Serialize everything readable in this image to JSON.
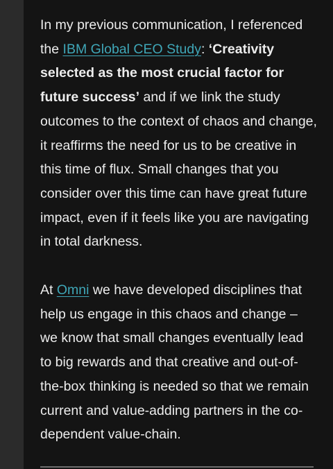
{
  "article": {
    "paragraph1": {
      "intro": "In my previous communication, I referenced the ",
      "link": "IBM Global CEO Study",
      "colon": ": ",
      "quote": "‘Creativity selected as the most crucial factor for future success’",
      "rest": " and if we link the study outcomes to the context of chaos and change, it reaffirms the need for us to be creative in this time of flux. Small changes that you consider over this time can have great future impact, even if it feels like you are navigating in total darkness."
    },
    "paragraph2": {
      "intro": "At ",
      "link": "Omni",
      "rest": " we have developed disciplines that help us engage in this chaos and change – we know that small changes eventually lead to big rewards and that creative and out-of-the-box thinking is needed so that we remain current and value-adding partners in the co-dependent value-chain."
    }
  },
  "colors": {
    "page_background": "#2b2b2b",
    "content_background": "#141414",
    "text": "#ececec",
    "link": "#3fa7b8",
    "divider": "#6e6e6e"
  }
}
